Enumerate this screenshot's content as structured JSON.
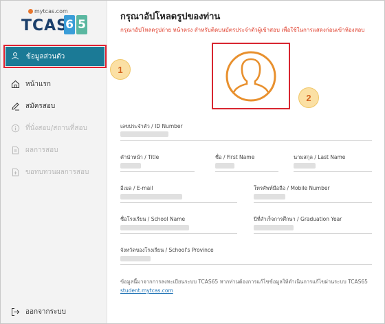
{
  "logo": {
    "site": "mytcas.com",
    "brand": "TCAS",
    "digit1": "6",
    "digit2": "5"
  },
  "sidebar": {
    "items": [
      {
        "label": "ข้อมูลส่วนตัว",
        "icon": "user-icon",
        "state": "active"
      },
      {
        "label": "หน้าแรก",
        "icon": "home-icon",
        "state": "normal"
      },
      {
        "label": "สมัครสอบ",
        "icon": "pencil-icon",
        "state": "normal"
      },
      {
        "label": "ที่นั่งสอบ/สถานที่สอบ",
        "icon": "info-icon",
        "state": "disabled"
      },
      {
        "label": "ผลการสอบ",
        "icon": "document-icon",
        "state": "disabled"
      },
      {
        "label": "ขอทบทวนผลการสอบ",
        "icon": "document-add-icon",
        "state": "disabled"
      }
    ],
    "logout_label": "ออกจากระบบ"
  },
  "annotations": {
    "badge1": "1",
    "badge2": "2"
  },
  "main": {
    "title": "กรุณาอัปโหลดรูปของท่าน",
    "subtitle": "กรุณาอัปโหลดรูปถ่าย หน้าตรง สำหรับติดบนบัตรประจำตัวผู้เข้าสอบ เพื่อใช้ในการแสดงก่อนเข้าห้องสอบ",
    "fields": {
      "id_number": "เลขประจำตัว / ID Number",
      "title": "คำนำหน้า / Title",
      "first_name": "ชื่อ / First Name",
      "last_name": "นามสกุล / Last Name",
      "email": "อีเมล / E-mail",
      "mobile": "โทรศัพท์มือถือ / Mobile Number",
      "school_name": "ชื่อโรงเรียน / School Name",
      "graduation_year": "ปีที่สำเร็จการศึกษา / Graduation Year",
      "school_province": "จังหวัดของโรงเรียน / School's Province"
    },
    "footer_note": "ข้อมูลนี้มาจากการลงทะเบียนระบบ TCAS65 หากท่านต้องการแก้ไขข้อมูลให้ดำเนินการแก้ไขผ่านระบบ TCAS65",
    "footer_link": "student.mytcas.com"
  },
  "colors": {
    "accent": "#1b7a96",
    "highlight": "#d82630",
    "avatar": "#e8902e",
    "subtitle": "#e0402e"
  }
}
